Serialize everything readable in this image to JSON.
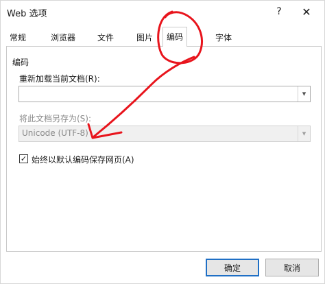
{
  "window": {
    "title": "Web 选项",
    "help_label": "?",
    "close_label": "✕"
  },
  "tabs": [
    {
      "label": "常规",
      "selected": false
    },
    {
      "label": "浏览器",
      "selected": false
    },
    {
      "label": "文件",
      "selected": false
    },
    {
      "label": "图片",
      "selected": false
    },
    {
      "label": "编码",
      "selected": true
    },
    {
      "label": "字体",
      "selected": false
    }
  ],
  "encoding": {
    "group_label": "编码",
    "reload_label": "重新加载当前文档(R):",
    "reload_value": "",
    "save_as_label": "将此文档另存为(S):",
    "save_as_value": "Unicode (UTF-8)",
    "always_save_label": "始终以默认编码保存网页(A)",
    "always_save_checked": true,
    "check_mark": "✓"
  },
  "buttons": {
    "ok_label": "确定",
    "cancel_label": "取消"
  },
  "icons": {
    "dropdown": "chevron-down-icon",
    "annotation_color": "#e8141c"
  }
}
